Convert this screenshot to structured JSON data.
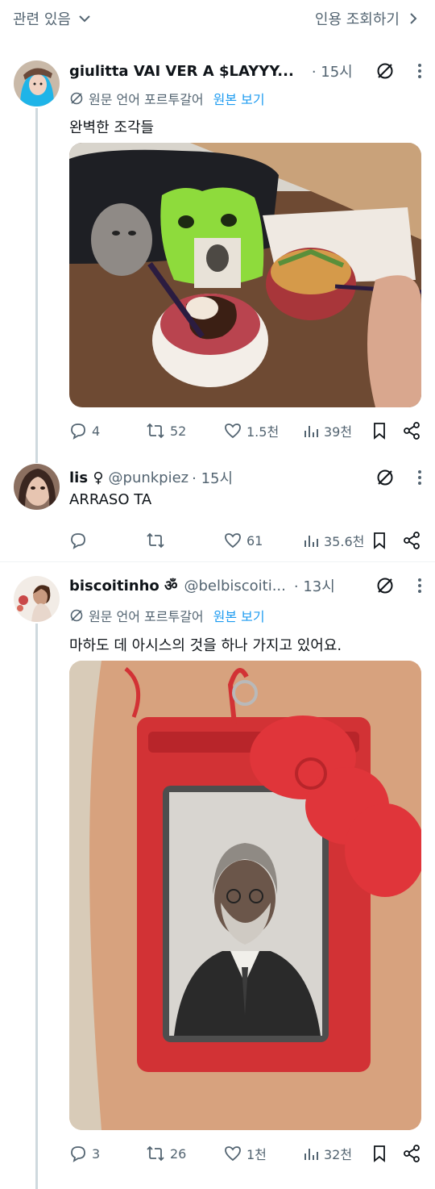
{
  "topbar": {
    "left_label": "관련 있음",
    "right_label": "인용 조회하기"
  },
  "tweets": [
    {
      "name": "giulitta VAI VER A $LAYYY...",
      "handle": "",
      "time": "· 15시",
      "translate_note": "원문 언어 포르투갈어",
      "translate_link": "원본 보기",
      "text": "완벽한 조각들",
      "stats": {
        "replies": "4",
        "retweets": "52",
        "likes": "1.5천",
        "views": "39천"
      }
    },
    {
      "name": "lis ♀",
      "handle": "@punkpiez",
      "time": "· 15시",
      "text": "ARRASO TA",
      "stats": {
        "replies": "",
        "retweets": "",
        "likes": "61",
        "views": "35.6천"
      }
    },
    {
      "name": "biscoitinho ॐ",
      "handle": "@belbiscoiti...",
      "time": "· 13시",
      "translate_note": "원문 언어 포르투갈어",
      "translate_link": "원본 보기",
      "text": "마하도 데 아시스의 것을 하나 가지고 있어요.",
      "stats": {
        "replies": "3",
        "retweets": "26",
        "likes": "1천",
        "views": "32천"
      }
    }
  ],
  "colors": {
    "text": "#0f1419",
    "muted": "#536471",
    "link": "#1d9bf0",
    "line": "#cfd9de"
  }
}
